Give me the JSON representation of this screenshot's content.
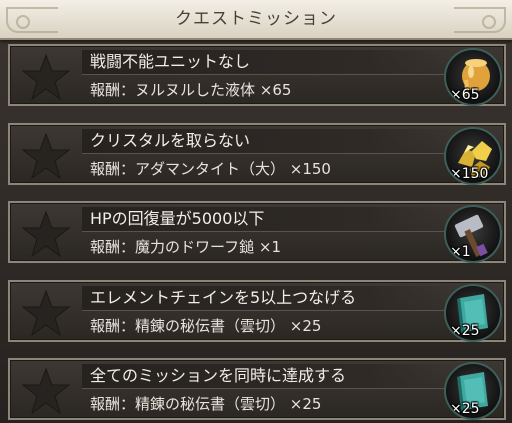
{
  "header": {
    "title": "クエストミッション"
  },
  "missions": [
    {
      "title": "戦闘不能ユニットなし",
      "reward": "報酬：ヌルヌルした液体 ×65",
      "quantity": "×65",
      "icon": "jar-of-liquid-icon"
    },
    {
      "title": "クリスタルを取らない",
      "reward": "報酬：アダマンタイト（大） ×150",
      "quantity": "×150",
      "icon": "gold-ore-icon"
    },
    {
      "title": "HPの回復量が5000以下",
      "reward": "報酬：魔力のドワーフ鎚 ×1",
      "quantity": "×1",
      "icon": "hammer-icon"
    },
    {
      "title": "エレメントチェインを5以上つなげる",
      "reward": "報酬：精錬の秘伝書（雲切） ×25",
      "quantity": "×25",
      "icon": "secret-book-icon"
    },
    {
      "title": "全てのミッションを同時に達成する",
      "reward": "報酬：精錬の秘伝書（雲切） ×25",
      "quantity": "×25",
      "icon": "secret-book-icon"
    }
  ]
}
